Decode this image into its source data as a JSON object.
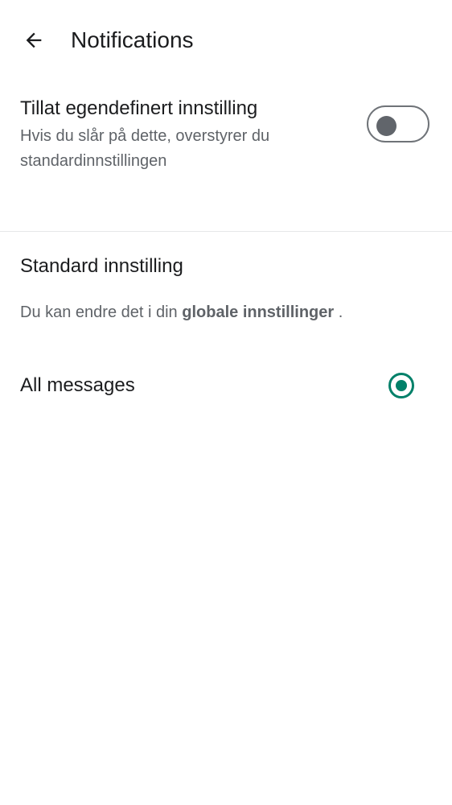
{
  "header": {
    "back_icon": "arrow-left-icon",
    "title": "Notifications"
  },
  "custom_setting": {
    "title": "Tillat egendefinert innstilling",
    "description": "Hvis du slår på dette, overstyrer du standardinnstillingen",
    "toggle_on": false
  },
  "standard_section": {
    "title": "Standard innstilling",
    "description_prefix": "Du kan endre det i din ",
    "link_text": "globale innstillinger",
    "description_suffix": " ."
  },
  "options": [
    {
      "label": "All messages",
      "selected": true
    }
  ],
  "colors": {
    "accent": "#008069",
    "toggle_off": "#61656b",
    "secondary_text": "#5f6368",
    "primary_text": "#1b1c1e"
  }
}
